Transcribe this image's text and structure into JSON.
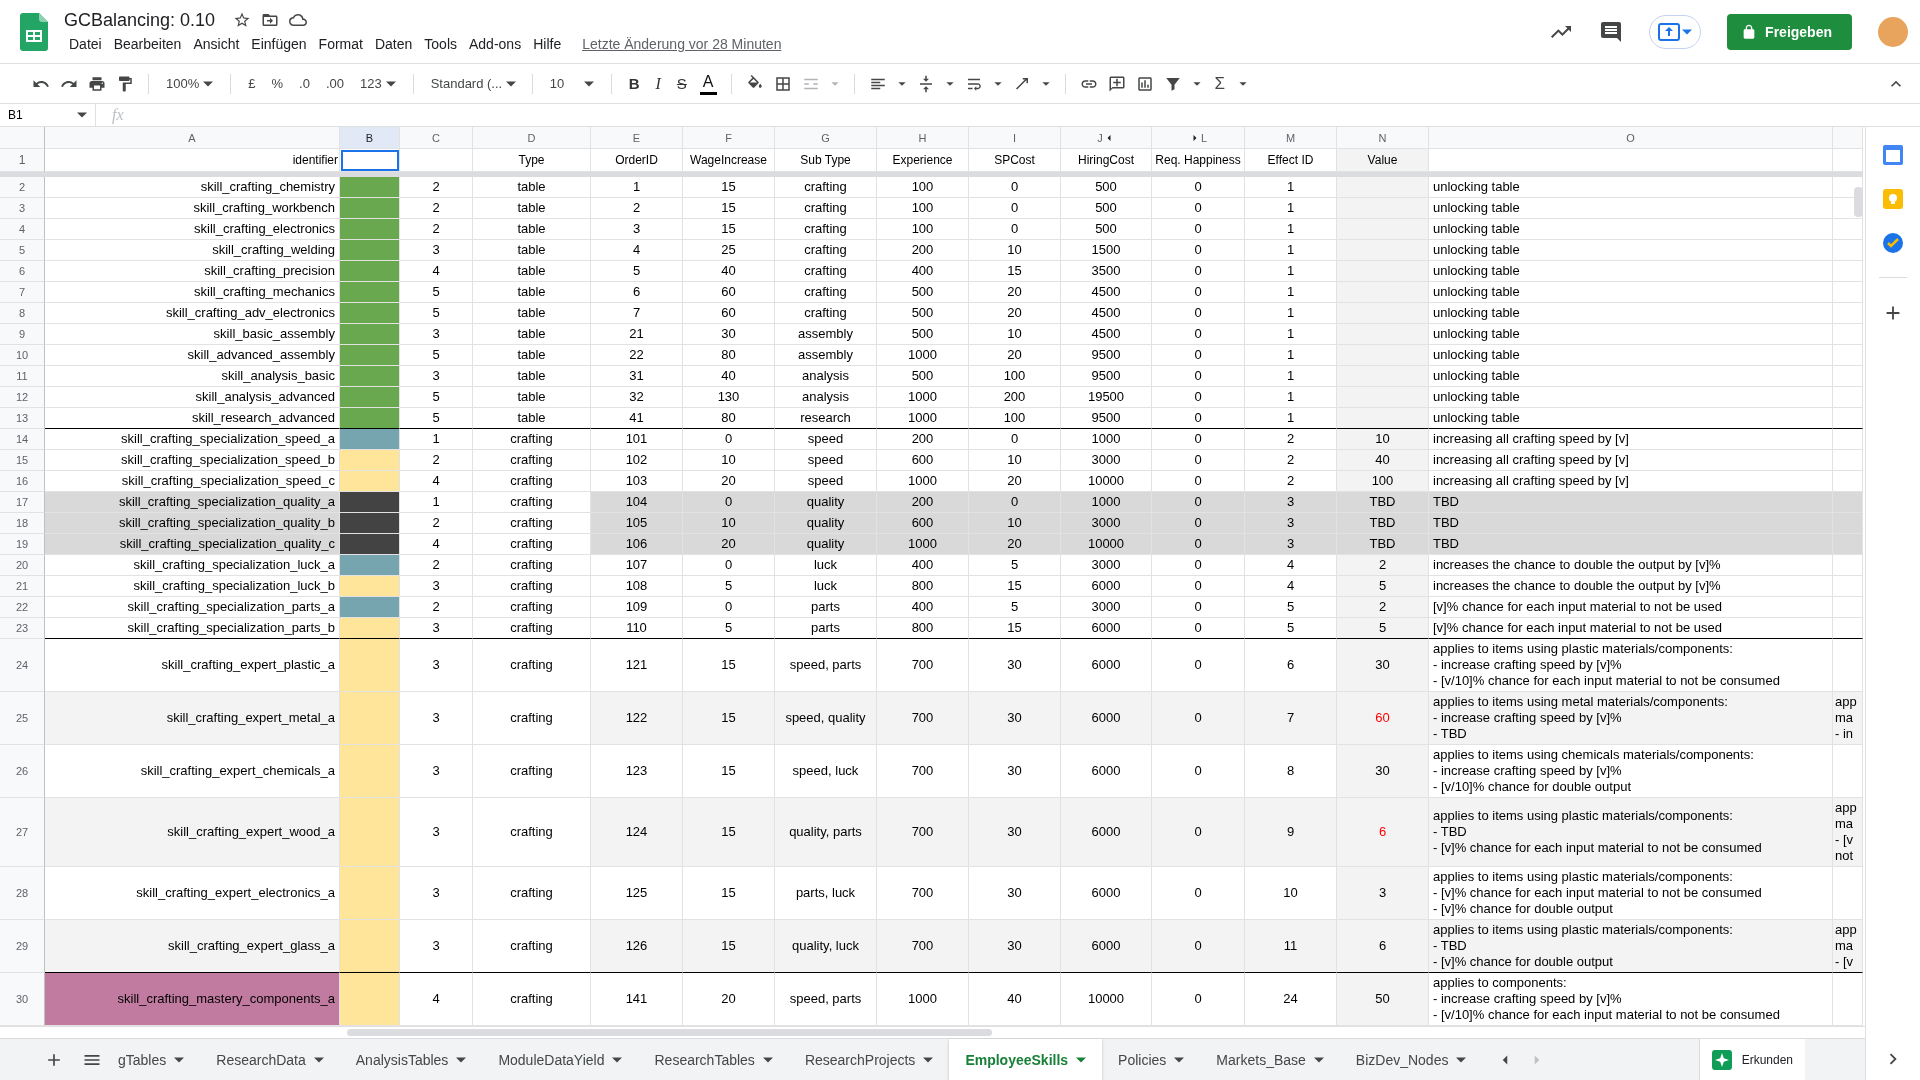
{
  "title": "GCBalancing: 0.10",
  "menu": [
    "Datei",
    "Bearbeiten",
    "Ansicht",
    "Einfügen",
    "Format",
    "Daten",
    "Tools",
    "Add-ons",
    "Hilfe"
  ],
  "last_edit": "Letzte Änderung vor 28 Minuten",
  "share_button": "Freigeben",
  "toolbar": {
    "zoom": "100%",
    "currency": "£",
    "percent": "%",
    "decrease_decimals": ".0",
    "increase_decimals": ".00",
    "more_formats": "123",
    "font": "Standard (...",
    "font_size": "10",
    "bold": "B",
    "italic": "I",
    "strikethrough": "S",
    "text_color": "A",
    "functions": "Σ"
  },
  "name_box": "B1",
  "formula_label": "fx",
  "column_letters": [
    "A",
    "B",
    "C",
    "D",
    "E",
    "F",
    "G",
    "H",
    "I",
    "J",
    "L",
    "M",
    "N",
    "O"
  ],
  "header_row": {
    "number": "1",
    "identifier": "identifier",
    "column_b_selected": true,
    "type": "Type",
    "order_id": "OrderID",
    "wage_increase": "WageIncrease",
    "sub_type": "Sub Type",
    "experience": "Experience",
    "sp_cost": "SPCost",
    "hiring_cost": "HiringCost",
    "req_happiness": "Req. Happiness",
    "effect_id": "Effect ID",
    "value": "Value"
  },
  "row_groups": [
    {
      "rows": [
        {
          "number": "2",
          "identifier": "skill_crafting_chemistry",
          "color": "#6aa84f",
          "column_c": "2",
          "type": "table",
          "order_id": "1",
          "wage_increase": "15",
          "sub_type": "crafting",
          "experience": "100",
          "sp_cost": "0",
          "hiring_cost": "500",
          "req_happiness": "0",
          "effect_id": "1",
          "column_o": "unlocking table"
        },
        {
          "number": "3",
          "identifier": "skill_crafting_workbench",
          "color": "#6aa84f",
          "column_c": "2",
          "type": "table",
          "order_id": "2",
          "wage_increase": "15",
          "sub_type": "crafting",
          "experience": "100",
          "sp_cost": "0",
          "hiring_cost": "500",
          "req_happiness": "0",
          "effect_id": "1",
          "column_o": "unlocking table"
        },
        {
          "number": "4",
          "identifier": "skill_crafting_electronics",
          "color": "#6aa84f",
          "column_c": "2",
          "type": "table",
          "order_id": "3",
          "wage_increase": "15",
          "sub_type": "crafting",
          "experience": "100",
          "sp_cost": "0",
          "hiring_cost": "500",
          "req_happiness": "0",
          "effect_id": "1",
          "column_o": "unlocking table"
        },
        {
          "number": "5",
          "identifier": "skill_crafting_welding",
          "color": "#6aa84f",
          "column_c": "3",
          "type": "table",
          "order_id": "4",
          "wage_increase": "25",
          "sub_type": "crafting",
          "experience": "200",
          "sp_cost": "10",
          "hiring_cost": "1500",
          "req_happiness": "0",
          "effect_id": "1",
          "column_o": "unlocking table"
        },
        {
          "number": "6",
          "identifier": "skill_crafting_precision",
          "color": "#6aa84f",
          "column_c": "4",
          "type": "table",
          "order_id": "5",
          "wage_increase": "40",
          "sub_type": "crafting",
          "experience": "400",
          "sp_cost": "15",
          "hiring_cost": "3500",
          "req_happiness": "0",
          "effect_id": "1",
          "column_o": "unlocking table"
        },
        {
          "number": "7",
          "identifier": "skill_crafting_mechanics",
          "color": "#6aa84f",
          "column_c": "5",
          "type": "table",
          "order_id": "6",
          "wage_increase": "60",
          "sub_type": "crafting",
          "experience": "500",
          "sp_cost": "20",
          "hiring_cost": "4500",
          "req_happiness": "0",
          "effect_id": "1",
          "column_o": "unlocking table"
        },
        {
          "number": "8",
          "identifier": "skill_crafting_adv_electronics",
          "color": "#6aa84f",
          "column_c": "5",
          "type": "table",
          "order_id": "7",
          "wage_increase": "60",
          "sub_type": "crafting",
          "experience": "500",
          "sp_cost": "20",
          "hiring_cost": "4500",
          "req_happiness": "0",
          "effect_id": "1",
          "column_o": "unlocking table"
        },
        {
          "number": "9",
          "identifier": "skill_basic_assembly",
          "color": "#6aa84f",
          "column_c": "3",
          "type": "table",
          "order_id": "21",
          "wage_increase": "30",
          "sub_type": "assembly",
          "experience": "500",
          "sp_cost": "10",
          "hiring_cost": "4500",
          "req_happiness": "0",
          "effect_id": "1",
          "column_o": "unlocking table"
        },
        {
          "number": "10",
          "identifier": "skill_advanced_assembly",
          "color": "#6aa84f",
          "column_c": "5",
          "type": "table",
          "order_id": "22",
          "wage_increase": "80",
          "sub_type": "assembly",
          "experience": "1000",
          "sp_cost": "20",
          "hiring_cost": "9500",
          "req_happiness": "0",
          "effect_id": "1",
          "column_o": "unlocking table"
        },
        {
          "number": "11",
          "identifier": "skill_analysis_basic",
          "color": "#6aa84f",
          "column_c": "3",
          "type": "table",
          "order_id": "31",
          "wage_increase": "40",
          "sub_type": "analysis",
          "experience": "500",
          "sp_cost": "100",
          "hiring_cost": "9500",
          "req_happiness": "0",
          "effect_id": "1",
          "column_o": "unlocking table"
        },
        {
          "number": "12",
          "identifier": "skill_analysis_advanced",
          "color": "#6aa84f",
          "column_c": "5",
          "type": "table",
          "order_id": "32",
          "wage_increase": "130",
          "sub_type": "analysis",
          "experience": "1000",
          "sp_cost": "200",
          "hiring_cost": "19500",
          "req_happiness": "0",
          "effect_id": "1",
          "column_o": "unlocking table"
        },
        {
          "number": "13",
          "identifier": "skill_research_advanced",
          "color": "#6aa84f",
          "column_c": "5",
          "type": "table",
          "order_id": "41",
          "wage_increase": "80",
          "sub_type": "research",
          "experience": "1000",
          "sp_cost": "100",
          "hiring_cost": "9500",
          "req_happiness": "0",
          "effect_id": "1",
          "column_o": "unlocking table"
        }
      ]
    },
    {
      "rows": [
        {
          "number": "14",
          "identifier": "skill_crafting_specialization_speed_a",
          "color": "#76a5af",
          "column_c": "1",
          "type": "crafting",
          "order_id": "101",
          "wage_increase": "0",
          "sub_type": "speed",
          "experience": "200",
          "sp_cost": "0",
          "hiring_cost": "1000",
          "req_happiness": "0",
          "effect_id": "2",
          "value": "10",
          "column_o": "increasing all crafting speed by [v]",
          "flagged": false
        },
        {
          "number": "15",
          "identifier": "skill_crafting_specialization_speed_b",
          "color": "#ffe599",
          "column_c": "2",
          "type": "crafting",
          "order_id": "102",
          "wage_increase": "10",
          "sub_type": "speed",
          "experience": "600",
          "sp_cost": "10",
          "hiring_cost": "3000",
          "req_happiness": "0",
          "effect_id": "2",
          "value": "40",
          "column_o": "increasing all crafting speed by [v]",
          "flagged": false
        },
        {
          "number": "16",
          "identifier": "skill_crafting_specialization_speed_c",
          "color": "#ffe599",
          "column_c": "4",
          "type": "crafting",
          "order_id": "103",
          "wage_increase": "20",
          "sub_type": "speed",
          "experience": "1000",
          "sp_cost": "20",
          "hiring_cost": "10000",
          "req_happiness": "0",
          "effect_id": "2",
          "value": "100",
          "column_o": "increasing all crafting speed by [v]",
          "flagged": false
        },
        {
          "number": "17",
          "identifier": "skill_crafting_specialization_quality_a",
          "color": "#434343",
          "column_c": "1",
          "type": "crafting",
          "order_id": "104",
          "wage_increase": "0",
          "sub_type": "quality",
          "experience": "200",
          "sp_cost": "0",
          "hiring_cost": "1000",
          "req_happiness": "0",
          "effect_id": "3",
          "value": "TBD",
          "column_o": "TBD",
          "flagged": false,
          "kind": "highlighted"
        },
        {
          "number": "18",
          "identifier": "skill_crafting_specialization_quality_b",
          "color": "#434343",
          "column_c": "2",
          "type": "crafting",
          "order_id": "105",
          "wage_increase": "10",
          "sub_type": "quality",
          "experience": "600",
          "sp_cost": "10",
          "hiring_cost": "3000",
          "req_happiness": "0",
          "effect_id": "3",
          "value": "TBD",
          "column_o": "TBD",
          "flagged": false,
          "kind": "highlighted"
        },
        {
          "number": "19",
          "identifier": "skill_crafting_specialization_quality_c",
          "color": "#434343",
          "column_c": "4",
          "type": "crafting",
          "order_id": "106",
          "wage_increase": "20",
          "sub_type": "quality",
          "experience": "1000",
          "sp_cost": "20",
          "hiring_cost": "10000",
          "req_happiness": "0",
          "effect_id": "3",
          "value": "TBD",
          "column_o": "TBD",
          "flagged": false,
          "kind": "highlighted"
        },
        {
          "number": "20",
          "identifier": "skill_crafting_specialization_luck_a",
          "color": "#76a5af",
          "column_c": "2",
          "type": "crafting",
          "order_id": "107",
          "wage_increase": "0",
          "sub_type": "luck",
          "experience": "400",
          "sp_cost": "5",
          "hiring_cost": "3000",
          "req_happiness": "0",
          "effect_id": "4",
          "value": "2",
          "column_o": "increases the chance to double the output by [v]%",
          "flagged": false
        },
        {
          "number": "21",
          "identifier": "skill_crafting_specialization_luck_b",
          "color": "#ffe599",
          "column_c": "3",
          "type": "crafting",
          "order_id": "108",
          "wage_increase": "5",
          "sub_type": "luck",
          "experience": "800",
          "sp_cost": "15",
          "hiring_cost": "6000",
          "req_happiness": "0",
          "effect_id": "4",
          "value": "5",
          "column_o": "increases the chance to double the output by [v]%",
          "flagged": false
        },
        {
          "number": "22",
          "identifier": "skill_crafting_specialization_parts_a",
          "color": "#76a5af",
          "column_c": "2",
          "type": "crafting",
          "order_id": "109",
          "wage_increase": "0",
          "sub_type": "parts",
          "experience": "400",
          "sp_cost": "5",
          "hiring_cost": "3000",
          "req_happiness": "0",
          "effect_id": "5",
          "value": "2",
          "column_o": "[v]% chance for each input material to not be used",
          "flagged": false
        },
        {
          "number": "23",
          "identifier": "skill_crafting_specialization_parts_b",
          "color": "#ffe599",
          "column_c": "3",
          "type": "crafting",
          "order_id": "110",
          "wage_increase": "5",
          "sub_type": "parts",
          "experience": "800",
          "sp_cost": "15",
          "hiring_cost": "6000",
          "req_happiness": "0",
          "effect_id": "5",
          "value": "5",
          "column_o": "[v]% chance for each input material to not be used",
          "flagged": false
        }
      ]
    },
    {
      "rows": [
        {
          "number": "24",
          "identifier": "skill_crafting_expert_plastic_a",
          "color": "#ffe599",
          "column_c": "3",
          "type": "crafting",
          "order_id": "121",
          "wage_increase": "15",
          "sub_type": "speed, parts",
          "experience": "700",
          "sp_cost": "30",
          "hiring_cost": "6000",
          "req_happiness": "0",
          "effect_id": "6",
          "value": "30",
          "column_o": "applies to items using plastic materials/components:\n- increase crafting speed by [v]%\n- [v/10]% chance for each input material to not be consumed",
          "flagged": false
        },
        {
          "number": "25",
          "identifier": "skill_crafting_expert_metal_a",
          "color": "#ffe599",
          "column_c": "3",
          "type": "crafting",
          "order_id": "122",
          "wage_increase": "15",
          "sub_type": "speed, quality",
          "experience": "700",
          "sp_cost": "30",
          "hiring_cost": "6000",
          "req_happiness": "0",
          "effect_id": "7",
          "value": "60",
          "column_o": "applies to items using metal materials/components:\n- increase crafting speed by [v]%\n- TBD",
          "column_p": "app\nma\n- in",
          "flagged": true,
          "kind": "banded"
        },
        {
          "number": "26",
          "identifier": "skill_crafting_expert_chemicals_a",
          "color": "#ffe599",
          "column_c": "3",
          "type": "crafting",
          "order_id": "123",
          "wage_increase": "15",
          "sub_type": "speed, luck",
          "experience": "700",
          "sp_cost": "30",
          "hiring_cost": "6000",
          "req_happiness": "0",
          "effect_id": "8",
          "value": "30",
          "column_o": "applies to items using chemicals materials/components:\n- increase crafting speed by [v]%\n- [v/10]% chance for double output",
          "flagged": false
        },
        {
          "number": "27",
          "identifier": "skill_crafting_expert_wood_a",
          "color": "#ffe599",
          "column_c": "3",
          "type": "crafting",
          "order_id": "124",
          "wage_increase": "15",
          "sub_type": "quality, parts",
          "experience": "700",
          "sp_cost": "30",
          "hiring_cost": "6000",
          "req_happiness": "0",
          "effect_id": "9",
          "value": "6",
          "column_o": "applies to items using plastic materials/components:\n- TBD\n- [v]% chance for each input material to not be consumed",
          "column_p": "app\nma\n- [v\nnot",
          "flagged": true,
          "kind": "banded"
        },
        {
          "number": "28",
          "identifier": "skill_crafting_expert_electronics_a",
          "color": "#ffe599",
          "column_c": "3",
          "type": "crafting",
          "order_id": "125",
          "wage_increase": "15",
          "sub_type": "parts, luck",
          "experience": "700",
          "sp_cost": "30",
          "hiring_cost": "6000",
          "req_happiness": "0",
          "effect_id": "10",
          "value": "3",
          "column_o": "applies to items using plastic materials/components:\n- [v]% chance for each input material to not be consumed\n- [v]% chance for double output",
          "flagged": false
        },
        {
          "number": "29",
          "identifier": "skill_crafting_expert_glass_a",
          "color": "#ffe599",
          "column_c": "3",
          "type": "crafting",
          "order_id": "126",
          "wage_increase": "15",
          "sub_type": "quality, luck",
          "experience": "700",
          "sp_cost": "30",
          "hiring_cost": "6000",
          "req_happiness": "0",
          "effect_id": "11",
          "value": "6",
          "column_o": "applies to items using plastic materials/components:\n- TBD\n- [v]% chance for double output",
          "column_p": "app\nma\n- [v",
          "flagged": false,
          "kind": "banded"
        }
      ]
    },
    {
      "rows": [
        {
          "number": "30",
          "identifier": "skill_crafting_mastery_components_a",
          "kind": "marked",
          "color": "#ffe599",
          "column_c": "4",
          "type": "crafting",
          "order_id": "141",
          "wage_increase": "20",
          "sub_type": "speed, parts",
          "experience": "1000",
          "sp_cost": "40",
          "hiring_cost": "10000",
          "req_happiness": "0",
          "effect_id": "24",
          "value": "50",
          "column_o": "applies to components:\n- increase crafting speed by [v]%\n- [v/10]% chance for each input material to not be consumed",
          "flagged": false
        }
      ]
    }
  ],
  "sheet_tabs": [
    {
      "label": "gTables",
      "selected": false
    },
    {
      "label": "ResearchData",
      "selected": false
    },
    {
      "label": "AnalysisTables",
      "selected": false
    },
    {
      "label": "ModuleDataYield",
      "selected": false
    },
    {
      "label": "ResearchTables",
      "selected": false
    },
    {
      "label": "ResearchProjects",
      "selected": false
    },
    {
      "label": "EmployeeSkills",
      "selected": true
    },
    {
      "label": "Policies",
      "selected": false
    },
    {
      "label": "Markets_Base",
      "selected": false
    },
    {
      "label": "BizDev_Nodes",
      "selected": false
    }
  ],
  "explore_button": "Erkunden"
}
